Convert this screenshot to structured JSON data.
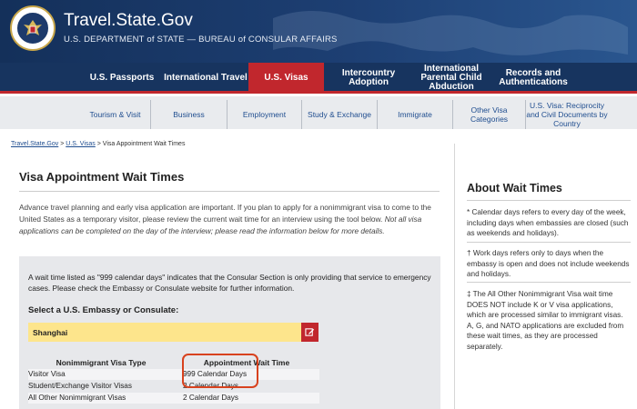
{
  "header": {
    "site_title": "Travel.State.Gov",
    "site_subtitle": "U.S. DEPARTMENT of STATE — BUREAU of CONSULAR AFFAIRS"
  },
  "main_nav": [
    {
      "label": "U.S. Passports"
    },
    {
      "label": "International Travel"
    },
    {
      "label": "U.S. Visas",
      "active": true
    },
    {
      "label": "Intercountry Adoption"
    },
    {
      "label": "International Parental Child Abduction"
    },
    {
      "label": "Records and Authentications"
    }
  ],
  "sub_nav": [
    {
      "label": "Tourism & Visit"
    },
    {
      "label": "Business"
    },
    {
      "label": "Employment"
    },
    {
      "label": "Study & Exchange"
    },
    {
      "label": "Immigrate"
    },
    {
      "label": "Other Visa Categories"
    },
    {
      "label": "U.S. Visa: Reciprocity and Civil Documents by Country"
    }
  ],
  "breadcrumb": {
    "home": "Travel.State.Gov",
    "sep1": " > ",
    "visas": "U.S. Visas",
    "sep2": " > ",
    "current": "Visa Appointment Wait Times"
  },
  "main": {
    "title": "Visa Appointment Wait Times",
    "intro_plain": "Advance travel planning and early visa application are important. If you plan to apply for a nonimmigrant visa to come to the United States as a temporary visitor, please review the current wait time for an interview using the tool below.",
    "intro_italic": "Not all visa applications can be completed on the day of the interview; please read the information below for more details.",
    "notice": "A wait time listed as \"999 calendar days\" indicates that the Consular Section is only providing that service to emergency cases. Please check the Embassy or Consulate website for further information.",
    "select_label": "Select a U.S. Embassy or Consulate:",
    "select_value": "Shanghai",
    "table": {
      "header_type": "Nonimmigrant Visa Type",
      "header_time": "Appointment Wait Time",
      "rows": [
        {
          "type": "Visitor Visa",
          "time": "999 Calendar Days"
        },
        {
          "type": "Student/Exchange Visitor Visas",
          "time": "2 Calendar Days"
        },
        {
          "type": "All Other Nonimmigrant Visas",
          "time": "2 Calendar Days"
        }
      ]
    }
  },
  "sidebar": {
    "title": "About Wait Times",
    "p1": "* Calendar days refers to every day of the week, including days when embassies are closed (such as weekends and holidays).",
    "p2": "† Work days refers only to days when the embassy is open and does not include weekends and holidays.",
    "p3": "‡ The All Other Nonimmigrant Visa wait time DOES NOT include K or V visa applications, which are processed similar to immigrant visas.  A, G, and NATO applications are excluded from these wait times, as they are processed separately."
  },
  "colors": {
    "header_blue": "#17345f",
    "accent_red": "#c1272d",
    "select_yellow": "#fde58c",
    "link_blue": "#1f4d8f",
    "highlight_orange": "#d8421e"
  },
  "icons": {
    "seal": "department-of-state-seal-icon",
    "edit": "pencil-square-icon"
  }
}
